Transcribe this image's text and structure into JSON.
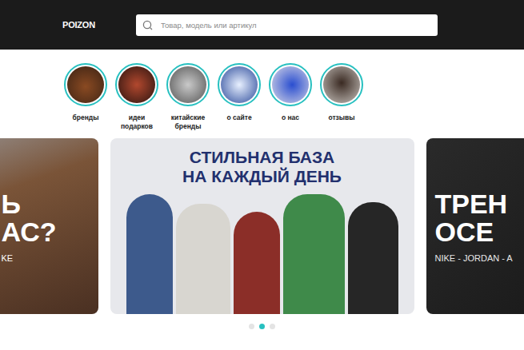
{
  "header": {
    "logo": "POIZON",
    "search": {
      "placeholder": "Товар, модель или артикул"
    }
  },
  "stories": [
    {
      "label": "бренды"
    },
    {
      "label": "идеи подарков"
    },
    {
      "label": "китайские бренды"
    },
    {
      "label": "о сайте"
    },
    {
      "label": "о нас"
    },
    {
      "label": "отзывы"
    }
  ],
  "banners": [
    {
      "lines": [
        "Ь",
        "АС?"
      ],
      "caption": "KE",
      "selected": false
    },
    {
      "lines": [
        "СТИЛЬНАЯ БАЗА",
        "НА КАЖДЫЙ ДЕНЬ"
      ],
      "selected": true
    },
    {
      "lines": [
        "ТРЕН",
        "ОСЕ"
      ],
      "caption": "NIKE - JORDAN - A",
      "selected": false
    }
  ],
  "pagination": [
    {
      "selected": false
    },
    {
      "selected": true
    },
    {
      "selected": false
    }
  ]
}
